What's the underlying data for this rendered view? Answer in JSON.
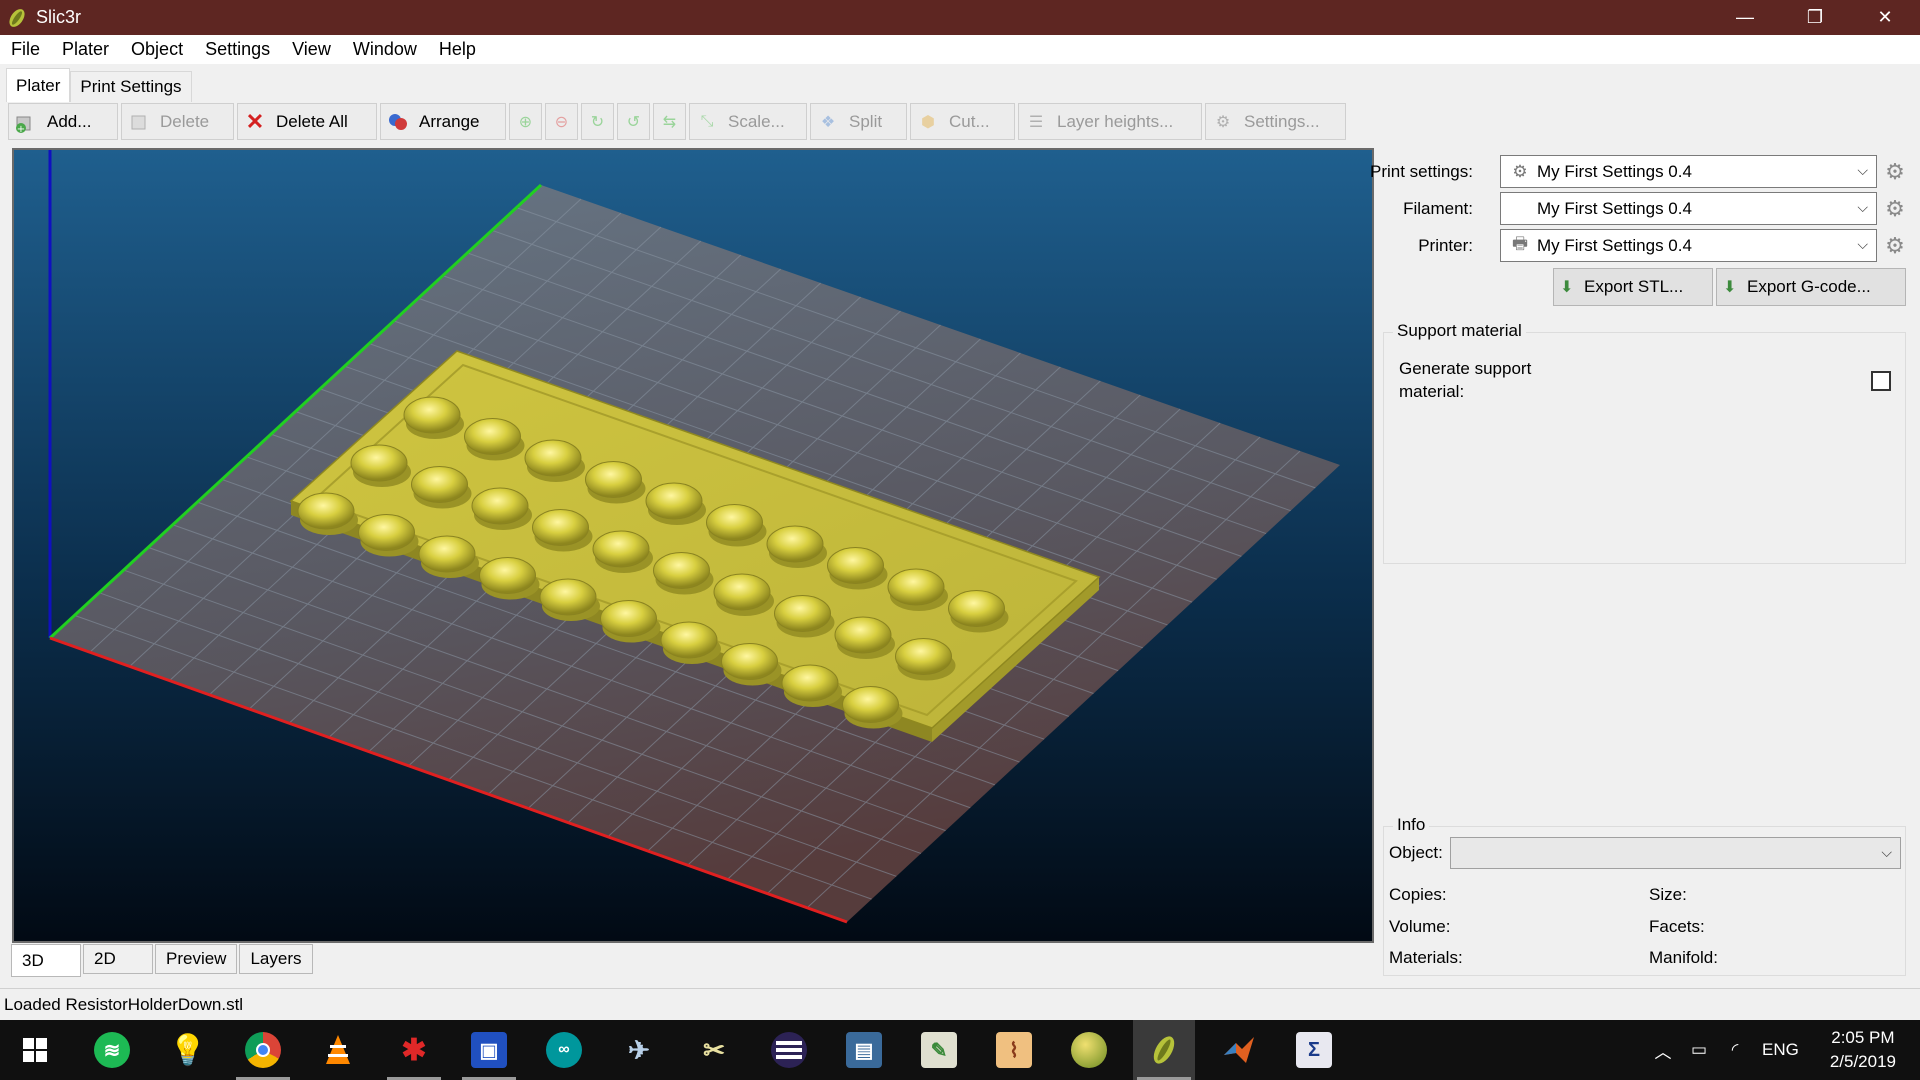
{
  "window": {
    "title": "Slic3r",
    "controls": {
      "minimize": "—",
      "restore": "❐",
      "close": "✕"
    }
  },
  "menu": [
    "File",
    "Plater",
    "Object",
    "Settings",
    "View",
    "Window",
    "Help"
  ],
  "tabs": [
    {
      "label": "Plater",
      "active": true
    },
    {
      "label": "Print Settings",
      "active": false
    }
  ],
  "toolbar": {
    "add": "Add...",
    "delete": "Delete",
    "delete_all": "Delete All",
    "arrange": "Arrange",
    "scale": "Scale...",
    "split": "Split",
    "cut": "Cut...",
    "layer_heights": "Layer heights...",
    "settings": "Settings..."
  },
  "view_tabs": [
    "3D",
    "2D",
    "Preview",
    "Layers"
  ],
  "presets": {
    "print_label": "Print settings:",
    "print_value": "My First Settings 0.4",
    "filament_label": "Filament:",
    "filament_value": "My First Settings 0.4",
    "printer_label": "Printer:",
    "printer_value": "My First Settings 0.4"
  },
  "export": {
    "stl": "Export STL...",
    "gcode": "Export G-code..."
  },
  "support": {
    "group_title": "Support material",
    "generate_label_line1": "Generate support",
    "generate_label_line2": "material:",
    "checked": false
  },
  "info": {
    "group_title": "Info",
    "object_label": "Object:",
    "object_value": "",
    "copies": "Copies:",
    "size": "Size:",
    "volume": "Volume:",
    "facets": "Facets:",
    "materials": "Materials:",
    "manifold": "Manifold:"
  },
  "status": "Loaded ResistorHolderDown.stl",
  "taskbar": {
    "language": "ENG",
    "time": "2:05 PM",
    "date": "2/5/2019"
  },
  "colors": {
    "titlebar": "#5e2622",
    "viewport_top": "#1f5f8e",
    "viewport_bottom": "#020a14",
    "part": "#c9c03a",
    "axis_x": "#e02020",
    "axis_y": "#20d020",
    "axis_z": "#1010c0"
  }
}
